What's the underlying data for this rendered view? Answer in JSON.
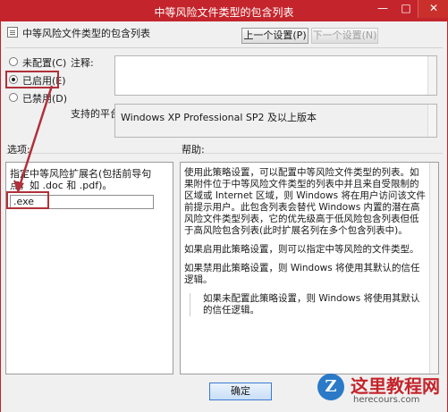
{
  "window": {
    "title": "中等风险文件类型的包含列表",
    "min_glyph": "—",
    "max_glyph": "□",
    "close_glyph": "✕"
  },
  "header": {
    "policy_name": "中等风险文件类型的包含列表"
  },
  "toolbar": {
    "prev_label": "上一个设置(P)",
    "next_label": "下一个设置(N)"
  },
  "state": {
    "options": [
      {
        "label": "未配置(C)",
        "checked": false
      },
      {
        "label": "已启用(E)",
        "checked": true
      },
      {
        "label": "已禁用(D)",
        "checked": false
      }
    ]
  },
  "comment": {
    "label": "注释:",
    "value": ""
  },
  "platform": {
    "label": "支持的平台:",
    "value": "Windows XP Professional SP2 及以上版本"
  },
  "options_section": {
    "label": "选项:",
    "description": "指定中等风险扩展名(包括前导句点，如 .doc 和 .pdf)。",
    "extension_value": ".exe"
  },
  "help_section": {
    "label": "帮助:",
    "paragraphs": [
      "使用此策略设置，可以配置中等风险文件类型的列表。如果附件位于中等风险文件类型的列表中并且来自受限制的区域或 Internet 区域，则 Windows 将在用户访问该文件前提示用户。此包含列表会替代 Windows 内置的潜在高风险文件类型列表，它的优先级高于低风险包含列表但低于高风险包含列表(此时扩展名列在多个包含列表中)。",
      "如果启用此策略设置，则可以指定中等风险的文件类型。",
      "如果禁用此策略设置，则 Windows 将使用其默认的信任逻辑。",
      "如果未配置此策略设置，则 Windows 将使用其默认的信任逻辑。"
    ]
  },
  "footer": {
    "ok_label": "确定"
  },
  "watermark": {
    "text": "这里教程网",
    "url": "herecours.com"
  },
  "colors": {
    "title_bar": "#c4242b",
    "highlight_box": "#b0313a",
    "ok_button_border": "#3a7ad0"
  }
}
